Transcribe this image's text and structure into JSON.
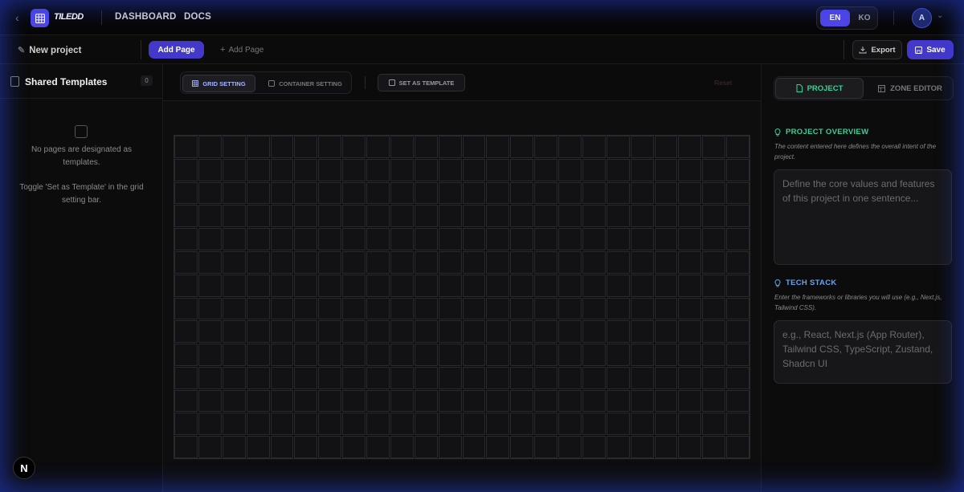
{
  "header": {
    "logo_text": "TILEDD",
    "nav": [
      "DASHBOARD",
      "DOCS"
    ],
    "languages": {
      "active": "EN",
      "other": "KO"
    },
    "avatar_initial": "A"
  },
  "toolbar": {
    "project_name": "New project",
    "add_page_primary": "Add Page",
    "add_page_ghost": "Add Page",
    "export_label": "Export",
    "save_label": "Save"
  },
  "left_panel": {
    "title": "Shared Templates",
    "count": "0",
    "empty_line1": "No pages are designated as templates.",
    "empty_line2": "Toggle 'Set as Template' in the grid setting bar."
  },
  "center": {
    "tab_grid": "GRID SETTING",
    "tab_container": "CONTAINER SETTING",
    "template_button": "SET AS TEMPLATE",
    "reset_label": "Reset",
    "grid": {
      "columns": 24,
      "rows": 14
    }
  },
  "right_panel": {
    "tab_project": "PROJECT",
    "tab_zone": "ZONE EDITOR",
    "overview_title": "PROJECT OVERVIEW",
    "overview_desc": "The content entered here defines the overall intent of the project.",
    "overview_placeholder": "Define the core values and features of this project in one sentence...",
    "tech_title": "TECH STACK",
    "tech_desc": "Enter the frameworks or libraries you will use (e.g., Next.js, Tailwind CSS).",
    "tech_placeholder": "e.g., React, Next.js (App Router), Tailwind CSS, TypeScript, Zustand, Shadcn UI"
  },
  "badge": "N",
  "colors": {
    "accent": "#4f46e5",
    "success": "#34d399",
    "info": "#60a5fa",
    "glow": "#2846e6"
  }
}
